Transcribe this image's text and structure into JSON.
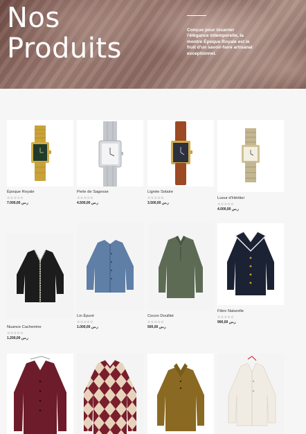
{
  "hero": {
    "title_line1": "Nos",
    "title_line2": "Produits",
    "description": "Conçue pour incarner l'élégance intemporelle, la montre Époque Royale est le fruit d'un savoir-faire artisanal exceptionnel."
  },
  "rating": "☆☆☆☆☆",
  "products": [
    {
      "name": "Époque Royale",
      "price": "7.000,00 ر.س"
    },
    {
      "name": "Perle de Sagesse",
      "price": "4.500,00 ر.س"
    },
    {
      "name": "Lignée Solaire",
      "price": "3.500,00 ر.س"
    },
    {
      "name": "Lueur d'Héritier",
      "price": "4.000,00 ر.س"
    },
    {
      "name": "Nuance Cachemire",
      "price": "1.200,00 ر.س"
    },
    {
      "name": "Lin Épuré",
      "price": "1.000,00 ر.س"
    },
    {
      "name": "Cocon Douillet",
      "price": "500,00 ر.س"
    },
    {
      "name": "Fibre Naturelle",
      "price": "900,00 ر.س"
    }
  ],
  "colors": {
    "page_bg": "#f6f6f6",
    "hero_overlay": "#8c6a62",
    "text": "#333333"
  }
}
